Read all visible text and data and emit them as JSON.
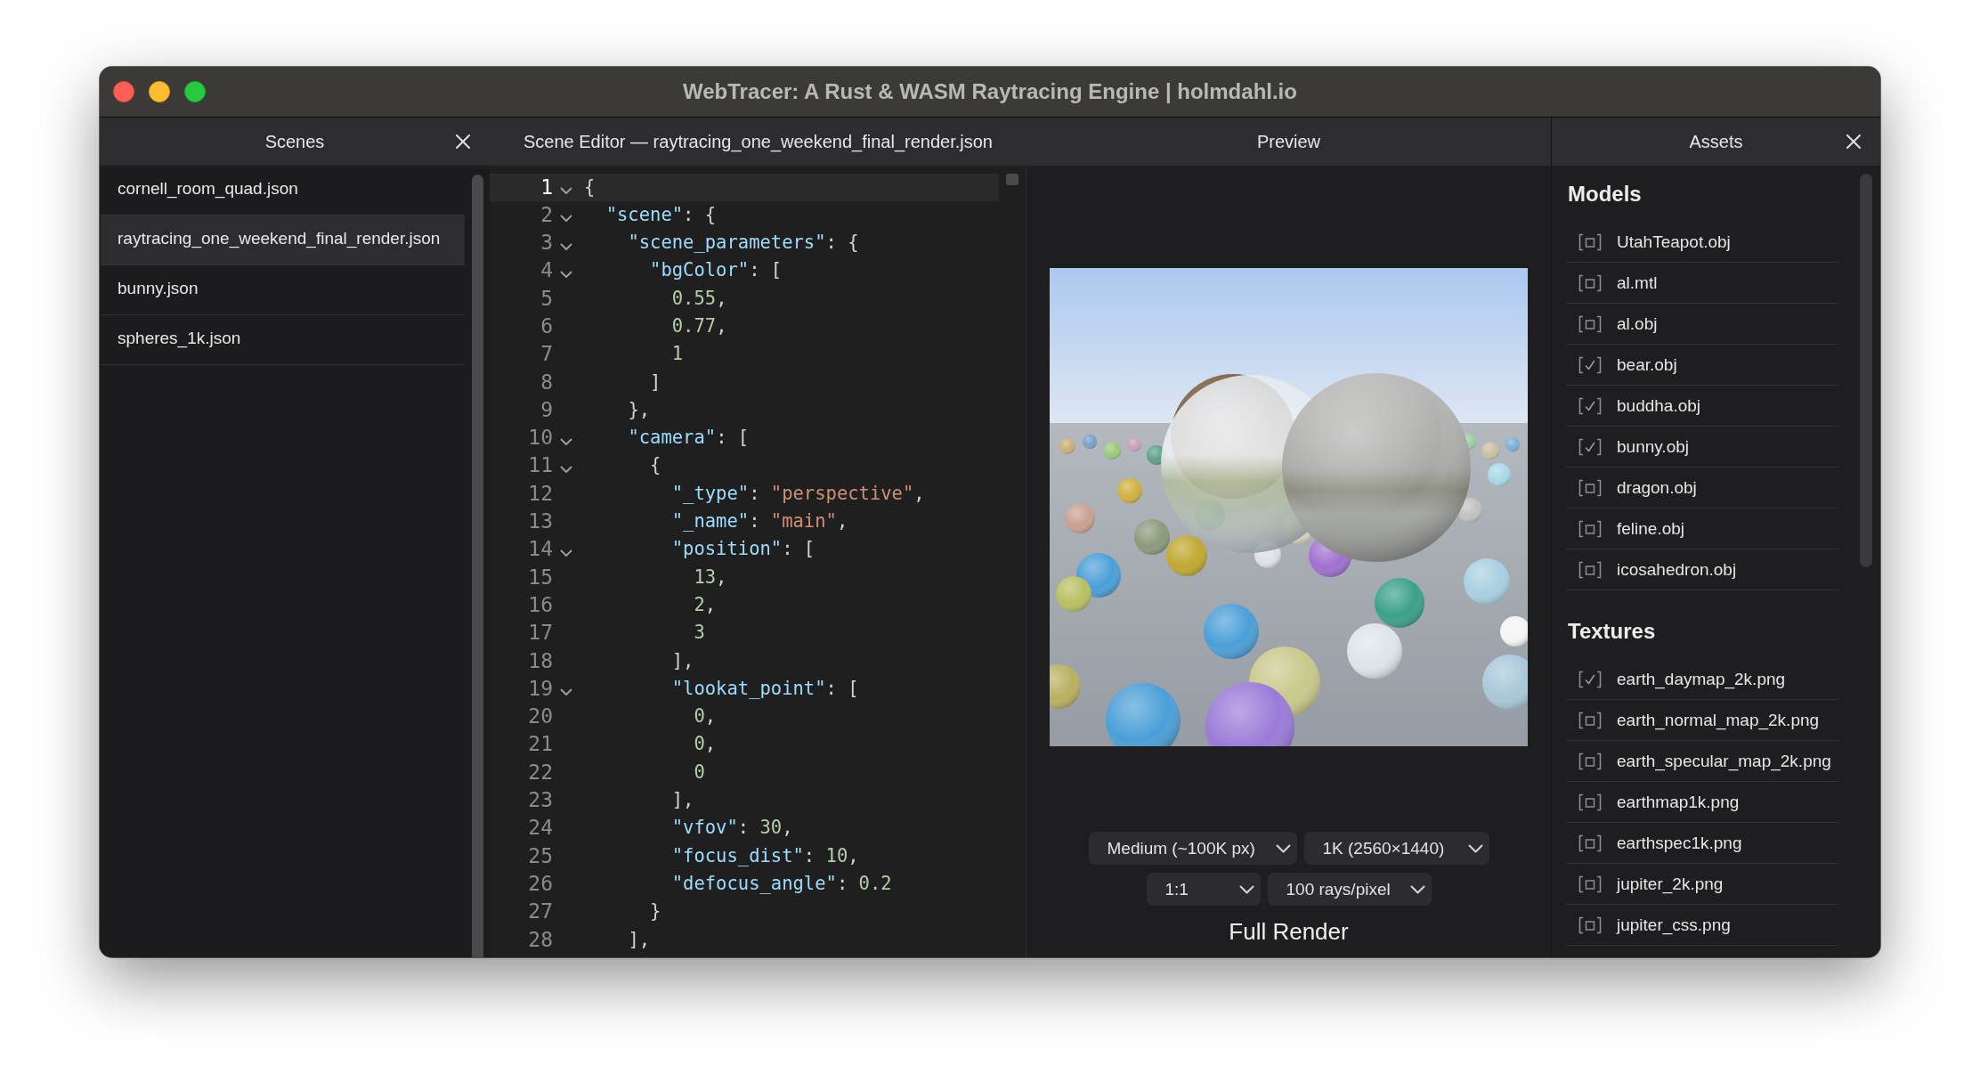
{
  "window": {
    "title": "WebTracer: A Rust & WASM Raytracing Engine | holmdahl.io"
  },
  "scenes": {
    "header": {
      "title": "Scenes",
      "closable": true
    },
    "items": [
      {
        "name": "cornell_room_quad.json",
        "selected": false
      },
      {
        "name": "raytracing_one_weekend_final_render.json",
        "selected": true
      },
      {
        "name": "bunny.json",
        "selected": false
      },
      {
        "name": "spheres_1k.json",
        "selected": false
      }
    ]
  },
  "editor": {
    "header": {
      "title": "Scene Editor — raytracing_one_weekend_final_render.json",
      "closable": false
    },
    "lines": [
      {
        "number": "1",
        "foldable": true,
        "current": true,
        "tokens": [
          {
            "kind": "punct",
            "text": "{"
          }
        ]
      },
      {
        "number": "2",
        "foldable": true,
        "current": false,
        "tokens": [
          {
            "kind": "key",
            "text": "  \"scene\""
          },
          {
            "kind": "punct",
            "text": ": {"
          }
        ]
      },
      {
        "number": "3",
        "foldable": true,
        "current": false,
        "tokens": [
          {
            "kind": "key",
            "text": "    \"scene_parameters\""
          },
          {
            "kind": "punct",
            "text": ": {"
          }
        ]
      },
      {
        "number": "4",
        "foldable": true,
        "current": false,
        "tokens": [
          {
            "kind": "key",
            "text": "      \"bgColor\""
          },
          {
            "kind": "punct",
            "text": ": ["
          }
        ]
      },
      {
        "number": "5",
        "foldable": false,
        "current": false,
        "tokens": [
          {
            "kind": "number",
            "text": "        0.55"
          },
          {
            "kind": "punct",
            "text": ","
          }
        ]
      },
      {
        "number": "6",
        "foldable": false,
        "current": false,
        "tokens": [
          {
            "kind": "number",
            "text": "        0.77"
          },
          {
            "kind": "punct",
            "text": ","
          }
        ]
      },
      {
        "number": "7",
        "foldable": false,
        "current": false,
        "tokens": [
          {
            "kind": "number",
            "text": "        1"
          }
        ]
      },
      {
        "number": "8",
        "foldable": false,
        "current": false,
        "tokens": [
          {
            "kind": "punct",
            "text": "      ]"
          }
        ]
      },
      {
        "number": "9",
        "foldable": false,
        "current": false,
        "tokens": [
          {
            "kind": "punct",
            "text": "    },"
          }
        ]
      },
      {
        "number": "10",
        "foldable": true,
        "current": false,
        "tokens": [
          {
            "kind": "key",
            "text": "    \"camera\""
          },
          {
            "kind": "punct",
            "text": ": ["
          }
        ]
      },
      {
        "number": "11",
        "foldable": true,
        "current": false,
        "tokens": [
          {
            "kind": "punct",
            "text": "      {"
          }
        ]
      },
      {
        "number": "12",
        "foldable": false,
        "current": false,
        "tokens": [
          {
            "kind": "key",
            "text": "        \"_type\""
          },
          {
            "kind": "punct",
            "text": ": "
          },
          {
            "kind": "string",
            "text": "\"perspective\""
          },
          {
            "kind": "punct",
            "text": ","
          }
        ]
      },
      {
        "number": "13",
        "foldable": false,
        "current": false,
        "tokens": [
          {
            "kind": "key",
            "text": "        \"_name\""
          },
          {
            "kind": "punct",
            "text": ": "
          },
          {
            "kind": "string",
            "text": "\"main\""
          },
          {
            "kind": "punct",
            "text": ","
          }
        ]
      },
      {
        "number": "14",
        "foldable": true,
        "current": false,
        "tokens": [
          {
            "kind": "key",
            "text": "        \"position\""
          },
          {
            "kind": "punct",
            "text": ": ["
          }
        ]
      },
      {
        "number": "15",
        "foldable": false,
        "current": false,
        "tokens": [
          {
            "kind": "number",
            "text": "          13"
          },
          {
            "kind": "punct",
            "text": ","
          }
        ]
      },
      {
        "number": "16",
        "foldable": false,
        "current": false,
        "tokens": [
          {
            "kind": "number",
            "text": "          2"
          },
          {
            "kind": "punct",
            "text": ","
          }
        ]
      },
      {
        "number": "17",
        "foldable": false,
        "current": false,
        "tokens": [
          {
            "kind": "number",
            "text": "          3"
          }
        ]
      },
      {
        "number": "18",
        "foldable": false,
        "current": false,
        "tokens": [
          {
            "kind": "punct",
            "text": "        ],"
          }
        ]
      },
      {
        "number": "19",
        "foldable": true,
        "current": false,
        "tokens": [
          {
            "kind": "key",
            "text": "        \"lookat_point\""
          },
          {
            "kind": "punct",
            "text": ": ["
          }
        ]
      },
      {
        "number": "20",
        "foldable": false,
        "current": false,
        "tokens": [
          {
            "kind": "number",
            "text": "          0"
          },
          {
            "kind": "punct",
            "text": ","
          }
        ]
      },
      {
        "number": "21",
        "foldable": false,
        "current": false,
        "tokens": [
          {
            "kind": "number",
            "text": "          0"
          },
          {
            "kind": "punct",
            "text": ","
          }
        ]
      },
      {
        "number": "22",
        "foldable": false,
        "current": false,
        "tokens": [
          {
            "kind": "number",
            "text": "          0"
          }
        ]
      },
      {
        "number": "23",
        "foldable": false,
        "current": false,
        "tokens": [
          {
            "kind": "punct",
            "text": "        ],"
          }
        ]
      },
      {
        "number": "24",
        "foldable": false,
        "current": false,
        "tokens": [
          {
            "kind": "key",
            "text": "        \"vfov\""
          },
          {
            "kind": "punct",
            "text": ": "
          },
          {
            "kind": "number",
            "text": "30"
          },
          {
            "kind": "punct",
            "text": ","
          }
        ]
      },
      {
        "number": "25",
        "foldable": false,
        "current": false,
        "tokens": [
          {
            "kind": "key",
            "text": "        \"focus_dist\""
          },
          {
            "kind": "punct",
            "text": ": "
          },
          {
            "kind": "number",
            "text": "10"
          },
          {
            "kind": "punct",
            "text": ","
          }
        ]
      },
      {
        "number": "26",
        "foldable": false,
        "current": false,
        "tokens": [
          {
            "kind": "key",
            "text": "        \"defocus_angle\""
          },
          {
            "kind": "punct",
            "text": ": "
          },
          {
            "kind": "number",
            "text": "0.2"
          }
        ]
      },
      {
        "number": "27",
        "foldable": false,
        "current": false,
        "tokens": [
          {
            "kind": "punct",
            "text": "      }"
          }
        ]
      },
      {
        "number": "28",
        "foldable": false,
        "current": false,
        "tokens": [
          {
            "kind": "punct",
            "text": "    ],"
          }
        ]
      }
    ]
  },
  "preview": {
    "header": {
      "title": "Preview",
      "closable": false
    },
    "dropdown_rows": [
      {
        "dropdowns": [
          {
            "value": "Medium (~100K px)"
          },
          {
            "value": "1K (2560×1440)"
          }
        ]
      },
      {
        "dropdowns": [
          {
            "value": "1:1"
          },
          {
            "value": "100 rays/pixel"
          }
        ]
      }
    ],
    "render_button": "Full Render"
  },
  "assets": {
    "header": {
      "title": "Assets",
      "closable": true
    },
    "sections": [
      {
        "title": "Models",
        "items": [
          {
            "name": "UtahTeapot.obj",
            "checked": false
          },
          {
            "name": "al.mtl",
            "checked": false
          },
          {
            "name": "al.obj",
            "checked": false
          },
          {
            "name": "bear.obj",
            "checked": true
          },
          {
            "name": "buddha.obj",
            "checked": true
          },
          {
            "name": "bunny.obj",
            "checked": true
          },
          {
            "name": "dragon.obj",
            "checked": false
          },
          {
            "name": "feline.obj",
            "checked": false
          },
          {
            "name": "icosahedron.obj",
            "checked": false
          }
        ]
      },
      {
        "title": "Textures",
        "items": [
          {
            "name": "earth_daymap_2k.png",
            "checked": true
          },
          {
            "name": "earth_normal_map_2k.png",
            "checked": false
          },
          {
            "name": "earth_specular_map_2k.png",
            "checked": false
          },
          {
            "name": "earthmap1k.png",
            "checked": false
          },
          {
            "name": "earthspec1k.png",
            "checked": false
          },
          {
            "name": "jupiter_2k.png",
            "checked": false
          },
          {
            "name": "jupiter_css.png",
            "checked": false
          }
        ]
      }
    ]
  }
}
